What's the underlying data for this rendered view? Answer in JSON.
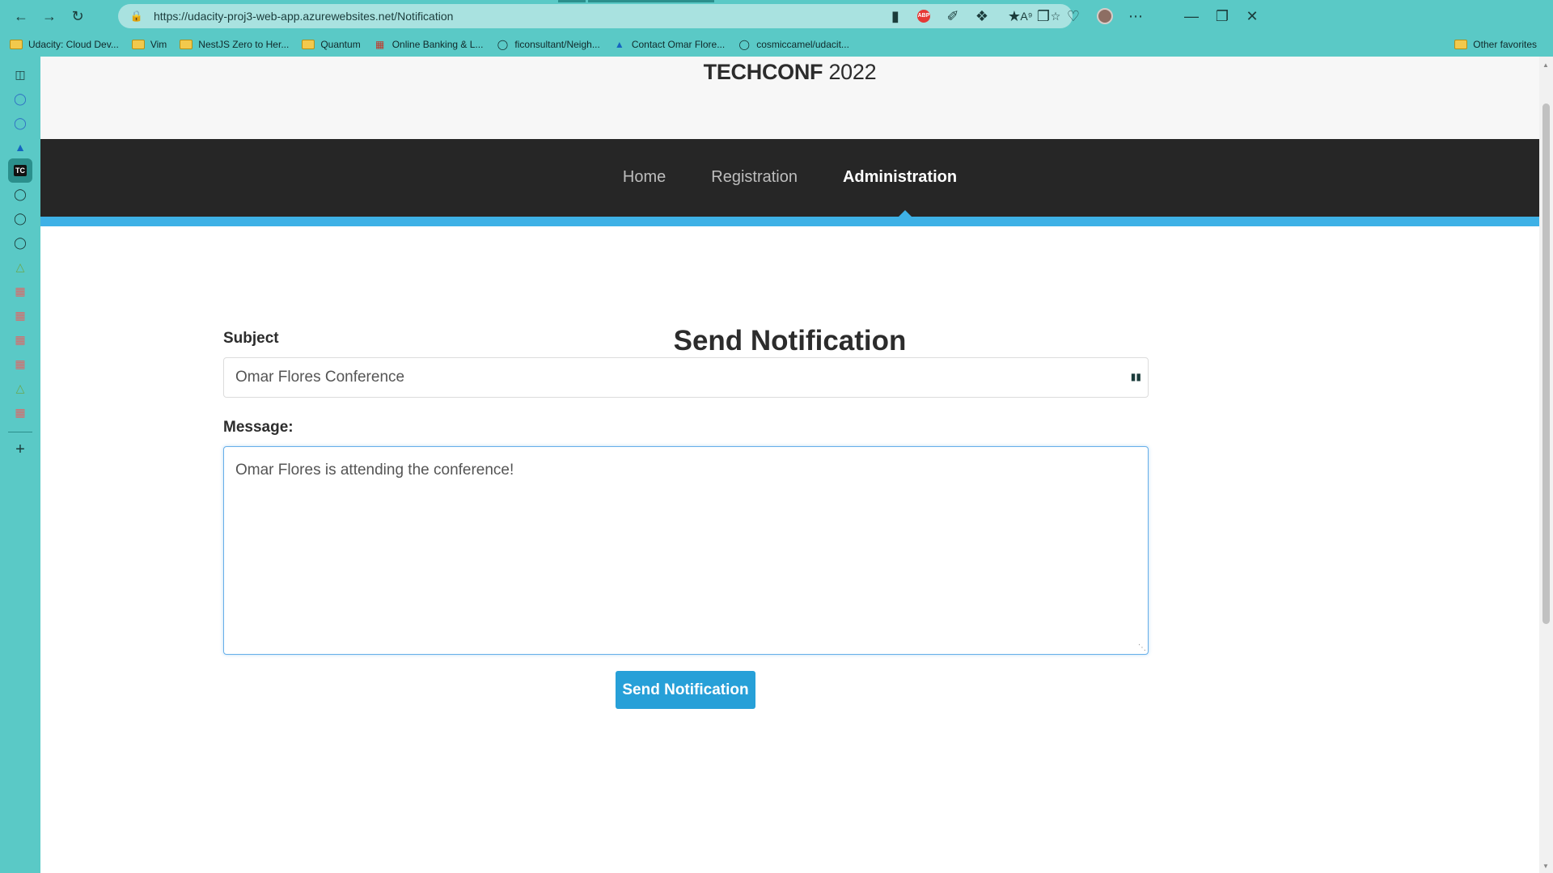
{
  "browser": {
    "url": "https://udacity-proj3-web-app.azurewebsites.net/Notification",
    "bookmarks": [
      {
        "label": "Udacity: Cloud Dev...",
        "icon": "folder-icon"
      },
      {
        "label": "Vim",
        "icon": "folder-icon"
      },
      {
        "label": "NestJS Zero to Her...",
        "icon": "folder-icon"
      },
      {
        "label": "Quantum",
        "icon": "folder-icon"
      },
      {
        "label": "Online Banking & L...",
        "icon": "bank-icon"
      },
      {
        "label": "ficonsultant/Neigh...",
        "icon": "github-icon"
      },
      {
        "label": "Contact Omar Flore...",
        "icon": "azure-icon"
      },
      {
        "label": "cosmiccamel/udacit...",
        "icon": "github-icon"
      }
    ],
    "other_favorites": "Other favorites",
    "sidebar_active_badge": "TC",
    "colors": {
      "chrome": "#5ac9c6",
      "address": "#a9e2e0"
    }
  },
  "site": {
    "brand_bold": "TECHCONF",
    "brand_year": "2022",
    "nav": {
      "home": "Home",
      "registration": "Registration",
      "administration": "Administration"
    },
    "colors": {
      "navbar": "#262626",
      "accent": "#3eb1e6",
      "button": "#27a0d8"
    }
  },
  "form": {
    "title": "Send Notification",
    "subject_label": "Subject",
    "subject_value": "Omar Flores Conference",
    "message_label": "Message:",
    "message_value": "Omar Flores is attending the conference!",
    "submit_label": "Send Notification"
  }
}
